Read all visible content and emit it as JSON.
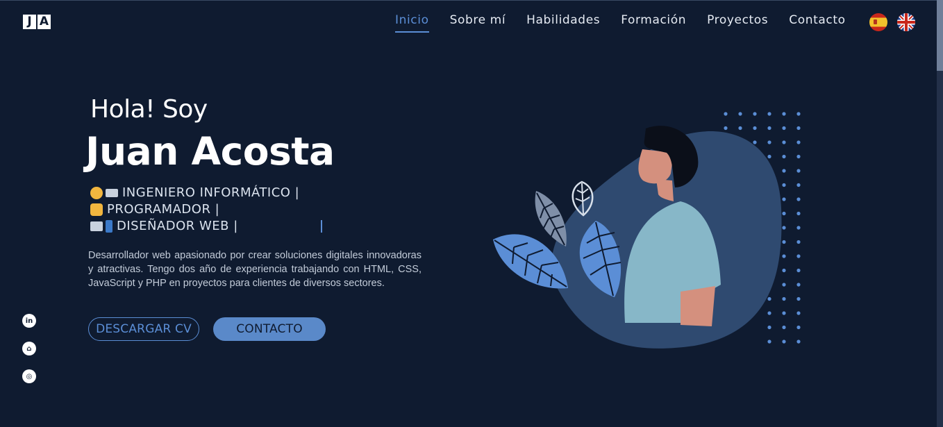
{
  "brand": {
    "logo_letters": [
      "J",
      "A"
    ]
  },
  "nav": {
    "items": [
      {
        "label": "Inicio",
        "active": true
      },
      {
        "label": "Sobre mí",
        "active": false
      },
      {
        "label": "Habilidades",
        "active": false
      },
      {
        "label": "Formación",
        "active": false
      },
      {
        "label": "Proyectos",
        "active": false
      },
      {
        "label": "Contacto",
        "active": false
      }
    ],
    "languages": [
      {
        "icon": "spain-flag-icon"
      },
      {
        "icon": "uk-flag-icon"
      }
    ]
  },
  "hero": {
    "greeting": "Hola! Soy",
    "name": "Juan Acosta",
    "roles": [
      {
        "text": "INGENIERO INFORMÁTICO |",
        "icons": [
          "technologist-face-icon",
          "laptop-icon"
        ]
      },
      {
        "text": "PROGRAMADOR |",
        "icons": [
          "technologist-icon"
        ]
      },
      {
        "text": "DISEÑADOR WEB |",
        "icons": [
          "desktop-icon",
          "mobile-phone-icon"
        ]
      }
    ],
    "description": "Desarrollador web apasionado por crear soluciones digitales innovadoras y atractivas. Tengo dos año de experiencia trabajando con HTML, CSS, JavaScript y PHP en proyectos para clientes de diversos sectores.",
    "buttons": {
      "download_cv": "DESCARGAR CV",
      "contact": "CONTACTO"
    }
  },
  "social": [
    {
      "icon": "linkedin-icon",
      "glyph": "in"
    },
    {
      "icon": "github-icon",
      "glyph": "⌂"
    },
    {
      "icon": "instagram-icon",
      "glyph": "◎"
    }
  ],
  "colors": {
    "background": "#0f1b30",
    "accent": "#5b8ed6",
    "button_fill": "#5a89c9",
    "blob": "#2f4a70"
  }
}
